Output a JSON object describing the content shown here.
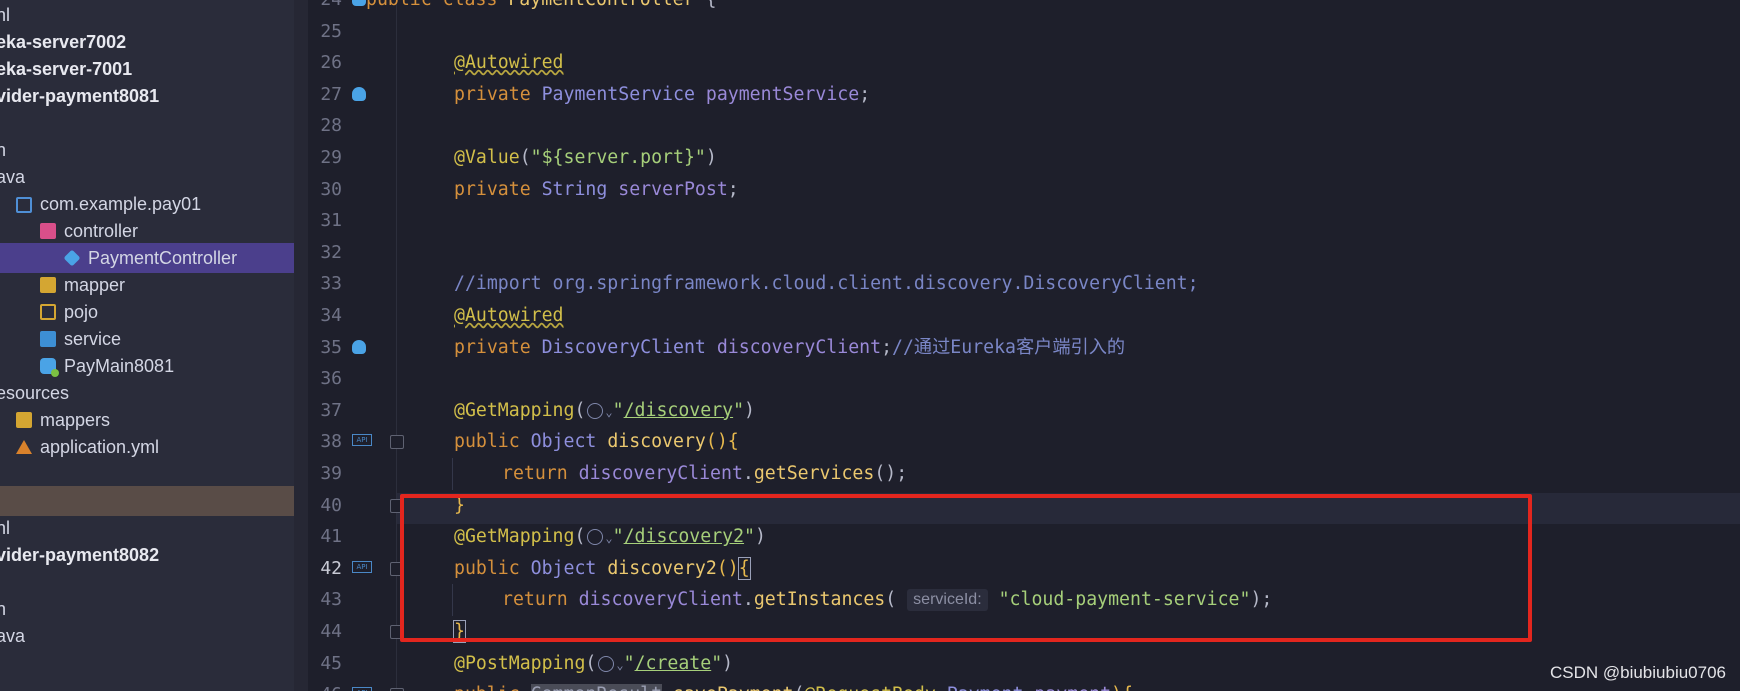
{
  "project_tree": {
    "items": [
      {
        "label": "nl",
        "style": "plain",
        "indent": 0,
        "icon": "none"
      },
      {
        "label": "eka-server7002",
        "style": "bold",
        "indent": 0,
        "icon": "none"
      },
      {
        "label": "eka-server-7001",
        "style": "bold",
        "indent": 0,
        "icon": "none"
      },
      {
        "label": "vider-payment8081",
        "style": "bold",
        "indent": 0,
        "icon": "none"
      },
      {
        "label": "",
        "style": "plain",
        "indent": 0,
        "icon": "none"
      },
      {
        "label": "n",
        "style": "plain",
        "indent": 0,
        "icon": "none"
      },
      {
        "label": "ava",
        "style": "plain",
        "indent": 0,
        "icon": "none"
      },
      {
        "label": "com.example.pay01",
        "style": "plain",
        "indent": 1,
        "icon": "package-icon"
      },
      {
        "label": "controller",
        "style": "plain",
        "indent": 2,
        "icon": "controller-folder-icon"
      },
      {
        "label": "PaymentController",
        "style": "selected",
        "indent": 3,
        "icon": "class-icon"
      },
      {
        "label": "mapper",
        "style": "plain",
        "indent": 2,
        "icon": "folder-icon"
      },
      {
        "label": "pojo",
        "style": "plain",
        "indent": 2,
        "icon": "pojo-folder-icon"
      },
      {
        "label": "service",
        "style": "plain",
        "indent": 2,
        "icon": "service-folder-icon"
      },
      {
        "label": "PayMain8081",
        "style": "plain",
        "indent": 2,
        "icon": "spring-class-icon"
      },
      {
        "label": "esources",
        "style": "plain",
        "indent": 0,
        "icon": "none"
      },
      {
        "label": "mappers",
        "style": "plain",
        "indent": 1,
        "icon": "folder-icon"
      },
      {
        "label": "application.yml",
        "style": "plain",
        "indent": 1,
        "icon": "yml-icon"
      },
      {
        "label": "",
        "style": "plain",
        "indent": 0,
        "icon": "none"
      },
      {
        "label": "",
        "style": "highlight",
        "indent": 0,
        "icon": "none"
      },
      {
        "label": "nl",
        "style": "plain",
        "indent": 0,
        "icon": "none"
      },
      {
        "label": "vider-payment8082",
        "style": "bold",
        "indent": 0,
        "icon": "none"
      },
      {
        "label": "",
        "style": "plain",
        "indent": 0,
        "icon": "none"
      },
      {
        "label": "n",
        "style": "plain",
        "indent": 0,
        "icon": "none"
      },
      {
        "label": "ava",
        "style": "plain",
        "indent": 0,
        "icon": "none"
      }
    ]
  },
  "editor": {
    "current_line": 42,
    "lines": [
      {
        "num": "24",
        "text": "public class PaymentController {"
      },
      {
        "num": "25",
        "text": ""
      },
      {
        "num": "26",
        "text": "@Autowired"
      },
      {
        "num": "27",
        "text": "private PaymentService paymentService;"
      },
      {
        "num": "28",
        "text": ""
      },
      {
        "num": "29",
        "text": "@Value(\"${server.port}\")"
      },
      {
        "num": "30",
        "text": "private String serverPost;"
      },
      {
        "num": "31",
        "text": ""
      },
      {
        "num": "32",
        "text": ""
      },
      {
        "num": "33",
        "text": "//import org.springframework.cloud.client.discovery.DiscoveryClient;"
      },
      {
        "num": "34",
        "text": "@Autowired"
      },
      {
        "num": "35",
        "text": "private DiscoveryClient discoveryClient;//通过Eureka客户端引入的"
      },
      {
        "num": "36",
        "text": ""
      },
      {
        "num": "37",
        "text": "@GetMapping(\"/discovery\")"
      },
      {
        "num": "38",
        "text": "public Object discovery(){"
      },
      {
        "num": "39",
        "text": "return discoveryClient.getServices();"
      },
      {
        "num": "40",
        "text": "}"
      },
      {
        "num": "41",
        "text": "@GetMapping(\"/discovery2\")"
      },
      {
        "num": "42",
        "text": "public Object discovery2(){"
      },
      {
        "num": "43",
        "text": "return discoveryClient.getInstances( serviceId: \"cloud-payment-service\");"
      },
      {
        "num": "44",
        "text": "}"
      },
      {
        "num": "45",
        "text": "@PostMapping(\"/create\")"
      },
      {
        "num": "46",
        "text": "public CommonResult savePayment(@RequestBody Payment payment){"
      }
    ],
    "tokens": {
      "public": "public",
      "class": "class",
      "private": "private",
      "return": "return",
      "PaymentController": "PaymentController",
      "Autowired": "@Autowired",
      "PaymentService": "PaymentService",
      "paymentService": "paymentService",
      "Value": "@Value",
      "server_port": "\"${server.port}\"",
      "String": "String",
      "serverPost": "serverPost",
      "import_comment": "//import org.springframework.cloud.client.discovery.DiscoveryClient;",
      "DiscoveryClient": "DiscoveryClient",
      "discoveryClient": "discoveryClient",
      "cn_comment": "//通过Eureka客户端引入的",
      "GetMapping": "@GetMapping",
      "PostMapping": "@PostMapping",
      "path_discovery": "/discovery",
      "path_discovery2": "/discovery2",
      "path_create": "/create",
      "Object": "Object",
      "discovery": "discovery",
      "discovery2": "discovery2",
      "getServices": "getServices",
      "getInstances": "getInstances",
      "hint_serviceId": "serviceId:",
      "cloud_payment_service": "\"cloud-payment-service\"",
      "CommonResult": "CommonResult",
      "savePayment": "savePayment",
      "RequestBody": "@RequestBody",
      "Payment": "Payment",
      "payment": "payment"
    },
    "gutter_icons": {
      "27": "bean-icon",
      "35": "bean-icon",
      "38": "api-icon",
      "42": "api-icon",
      "46": "api-icon",
      "24": "bean-icon"
    },
    "api_badge_label": "API"
  },
  "watermark": "CSDN @biubiubiu0706",
  "colors": {
    "highlight_box": "#e3261e",
    "selected_tree_row": "#4b3f8c",
    "keyword": "#d5903c",
    "string": "#a6cf7a",
    "annotation": "#d2bf4a"
  }
}
